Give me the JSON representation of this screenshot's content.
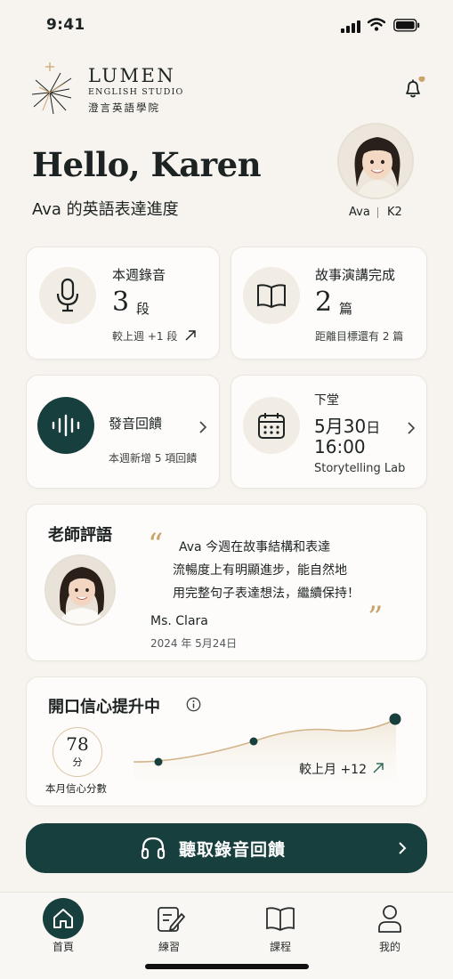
{
  "status": {
    "time": "9:41"
  },
  "brand": {
    "name": "LUMEN",
    "sub": "ENGLISH STUDIO",
    "chinese": "澄言英語學院"
  },
  "greeting": {
    "title": "Hello, Karen",
    "subtitle": "Ava 的英語表達進度"
  },
  "child": {
    "name": "Ava",
    "grade": "K2"
  },
  "stats": {
    "recordings": {
      "title": "本週錄音",
      "value": "3",
      "unit": "段",
      "note": "較上週 +1 段"
    },
    "stories": {
      "title": "故事演講完成",
      "value": "2",
      "unit": "篇",
      "note": "距離目標還有 2 篇"
    }
  },
  "feedback_card": {
    "title": "發音回饋",
    "note": "本週新增 5 項回饋"
  },
  "next_class": {
    "label": "下堂",
    "date_num": "5月30",
    "date_suffix": "日",
    "time": "16:00",
    "course": "Storytelling Lab"
  },
  "teacher": {
    "heading": "老師評語",
    "comment_lines": [
      "Ava 今週在故事結構和表達",
      "流暢度上有明顯進步，能自然地",
      "用完整句子表達想法，繼續保持！"
    ],
    "name": "Ms. Clara",
    "date": "2024 年 5月24日"
  },
  "confidence": {
    "heading": "開口信心提升中",
    "score": "78",
    "score_unit": "分",
    "score_label": "本月信心分數",
    "change": "較上月 +12"
  },
  "cta": {
    "label": "聽取錄音回饋"
  },
  "nav": [
    {
      "label": "首頁",
      "icon": "home-icon"
    },
    {
      "label": "練習",
      "icon": "edit-icon"
    },
    {
      "label": "課程",
      "icon": "book-icon"
    },
    {
      "label": "我的",
      "icon": "user-icon"
    }
  ],
  "colors": {
    "accent_dark": "#173f3d",
    "gold": "#c9a46a",
    "background": "#f7f4ef"
  }
}
